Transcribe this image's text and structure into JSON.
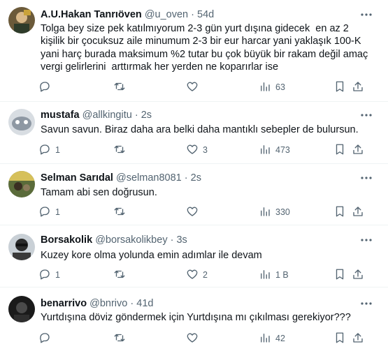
{
  "tweets": [
    {
      "name": "A.U.Hakan Tanrıöven",
      "handle": "@u_oven",
      "sep": "·",
      "time": "54d",
      "text": "Tolga bey size pek katılmıyorum 2-3 gün yurt dışına gidecek  en az 2 kişilik bir çocuksuz aile minumum 2-3 bir eur harcar yani yaklaşık 100-K  yani harç burada maksimum %2 tutar bu çok büyük bir rakam değil amaç vergi gelirlerini  arttırmak her yerden ne koparırlar ise",
      "replies": "",
      "retweets": "",
      "likes": "",
      "views": "63"
    },
    {
      "name": "mustafa",
      "handle": "@allkingitu",
      "sep": "·",
      "time": "2s",
      "text": "Savun savun. Biraz daha ara belki daha mantıklı sebepler de bulursun.",
      "replies": "1",
      "retweets": "",
      "likes": "3",
      "views": "473"
    },
    {
      "name": "Selman Sarıdal",
      "handle": "@selman8081",
      "sep": "·",
      "time": "2s",
      "text": "Tamam abi sen doğrusun.",
      "replies": "1",
      "retweets": "",
      "likes": "",
      "views": "330"
    },
    {
      "name": "Borsakolik",
      "handle": "@borsakolikbey",
      "sep": "·",
      "time": "3s",
      "text": "Kuzey kore olma yolunda emin adımlar ile devam",
      "replies": "1",
      "retweets": "",
      "likes": "2",
      "views": "1 B"
    },
    {
      "name": "benarrivo",
      "handle": "@bnrivo",
      "sep": "·",
      "time": "41d",
      "text": "Yurtdışına döviz göndermek için Yurtdışına mı çıkılması gerekiyor???",
      "replies": "",
      "retweets": "",
      "likes": "",
      "views": "42"
    }
  ],
  "icons": [
    "reply-icon",
    "retweet-icon",
    "like-icon",
    "views-icon",
    "bookmark-icon",
    "share-icon",
    "more-icon"
  ],
  "colors": {
    "text": "#0f1419",
    "secondary": "#536471",
    "divider": "#eff3f4"
  }
}
